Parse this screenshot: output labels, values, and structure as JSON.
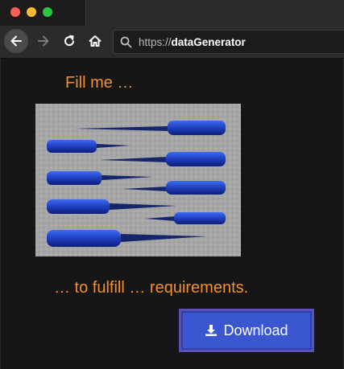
{
  "browser": {
    "url_scheme": "https://",
    "url_host": "dataGenerator",
    "traffic_light_colors": {
      "close": "#ff5f57",
      "minimize": "#febc2e",
      "zoom": "#28c840"
    },
    "icons": {
      "back": "arrow-left-icon",
      "forward": "arrow-right-icon",
      "reload": "reload-icon",
      "home": "home-icon",
      "search": "search-icon"
    }
  },
  "page": {
    "heading_top": "Fill me …",
    "heading_bottom": "… to fulfill … requirements.",
    "image": {
      "subject": "blue-handled screwdrivers arranged on a gray foam tray"
    },
    "download_button": {
      "label": "Download",
      "icon": "download-icon"
    },
    "accent_color": "#f4902a",
    "button_color": "#3a57cf"
  }
}
